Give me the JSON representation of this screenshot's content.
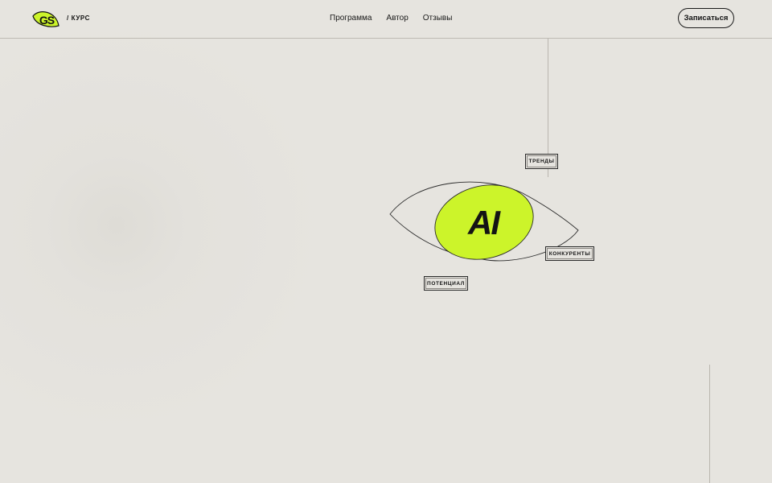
{
  "header": {
    "logo_text": "GS",
    "course_label": "/ КУРС",
    "nav": [
      {
        "label": "Программа"
      },
      {
        "label": "Автор"
      },
      {
        "label": "Отзывы"
      }
    ],
    "signup_label": "Записаться"
  },
  "hero": {
    "ai_text": "AI",
    "tags": {
      "trends": "ТРЕНДЫ",
      "competitors": "КОНКУРЕНТЫ",
      "potential": "ПОТЕНЦИАЛ"
    }
  },
  "colors": {
    "background": "#e6e4df",
    "accent": "#ccf42a",
    "ink": "#141414",
    "line": "#b9b6af"
  }
}
